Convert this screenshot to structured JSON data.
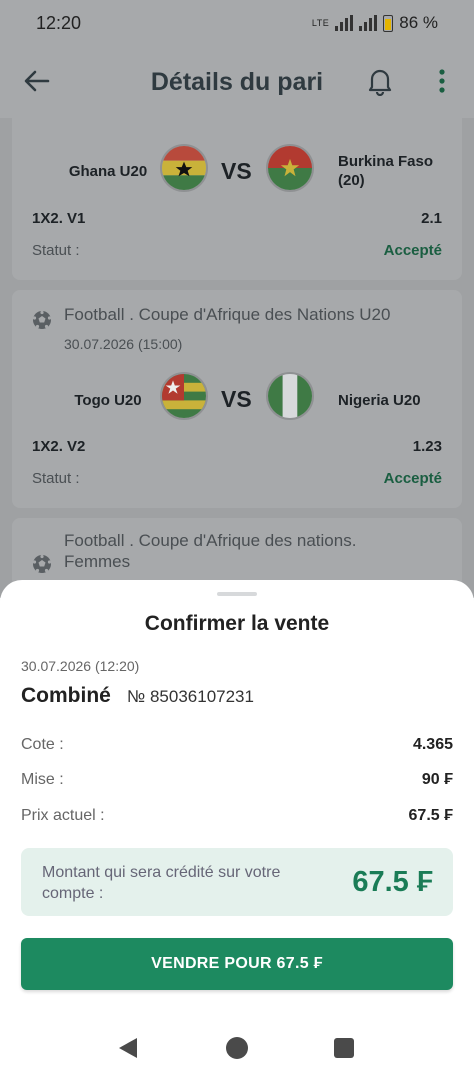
{
  "status_bar": {
    "time": "12:20",
    "network": "LTE",
    "battery": "86 %"
  },
  "app_bar": {
    "title": "Détails du pari"
  },
  "events": [
    {
      "team1": "Ghana U20",
      "team2": "Burkina Faso (20)",
      "vs": "VS",
      "market": "1X2. V1",
      "odd": "2.1",
      "status_label": "Statut :",
      "status": "Accepté"
    },
    {
      "league": "Football . Coupe d'Afrique des Nations U20",
      "date": "30.07.2026 (15:00)",
      "team1": "Togo U20",
      "team2": "Nigeria U20",
      "vs": "VS",
      "market": "1X2. V2",
      "odd": "1.23",
      "status_label": "Statut :",
      "status": "Accepté"
    },
    {
      "league": "Football . Coupe d'Afrique des nations. Femmes"
    }
  ],
  "sheet": {
    "title": "Confirmer la vente",
    "date": "30.07.2026 (12:20)",
    "bet_type": "Combiné",
    "bet_number": "№ 85036107231",
    "rows": [
      {
        "label": "Cote :",
        "value": "4.365"
      },
      {
        "label": "Mise :",
        "value": "90 ₣"
      },
      {
        "label": "Prix actuel :",
        "value": "67.5 ₣"
      }
    ],
    "credit_label": "Montant qui sera crédité sur votre compte :",
    "credit_value": "67.5 ₣",
    "sell_button": "VENDRE POUR 67.5 ₣"
  },
  "colors": {
    "accent": "#1d8a60",
    "accepted": "#1a7c56",
    "credit_bg": "#e4f1ec"
  }
}
